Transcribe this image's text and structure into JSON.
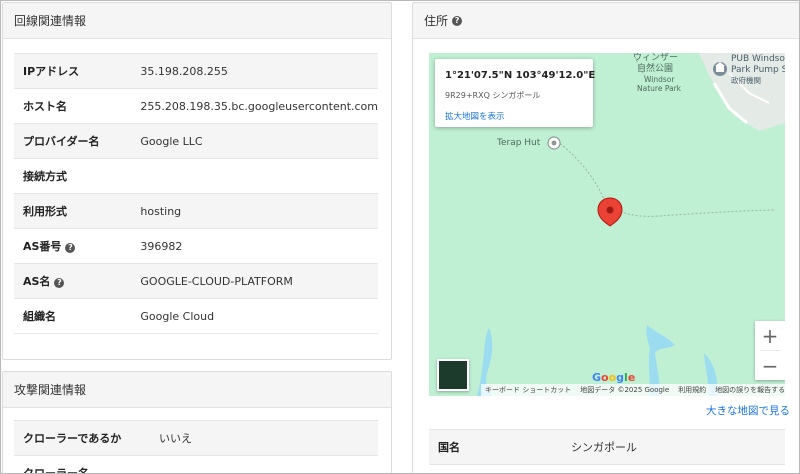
{
  "line_panel": {
    "title": "回線関連情報",
    "rows": [
      {
        "key": "IPアドレス",
        "value": "35.198.208.255",
        "help": false
      },
      {
        "key": "ホスト名",
        "value": "255.208.198.35.bc.googleusercontent.com",
        "help": false
      },
      {
        "key": "プロバイダー名",
        "value": "Google LLC",
        "help": false
      },
      {
        "key": "接続方式",
        "value": "",
        "help": false
      },
      {
        "key": "利用形式",
        "value": "hosting",
        "help": false
      },
      {
        "key": "AS番号",
        "value": "396982",
        "help": true
      },
      {
        "key": "AS名",
        "value": "GOOGLE-CLOUD-PLATFORM",
        "help": true
      },
      {
        "key": "組織名",
        "value": "Google Cloud",
        "help": false
      }
    ]
  },
  "attack_panel": {
    "title": "攻撃関連情報",
    "rows": [
      {
        "key": "クローラーであるか",
        "value": "いいえ"
      },
      {
        "key": "クローラー名",
        "value": ""
      }
    ]
  },
  "address_panel": {
    "title": "住所",
    "map": {
      "infocard": {
        "coordinates": "1°21'07.5\"N 103°49'12.0\"E",
        "plus_code": "9R29+RXQ シンガポール",
        "enlarge_link": "拡大地図を表示"
      },
      "labels": {
        "terap_hut": "Terap Hut",
        "windsor_jp1": "ウィンザー",
        "windsor_jp2": "自然公園",
        "windsor_en1": "Windsor",
        "windsor_en2": "Nature Park",
        "pub_line1": "PUB Windsor",
        "pub_line2": "Park Pump Sta",
        "pub_line3": "政府機関"
      },
      "zoom_in": "+",
      "zoom_out": "−",
      "logo": "Google",
      "attribution": [
        "キーボード ショートカット",
        "地図データ ©2025 Google",
        "利用規約",
        "地図の誤りを報告する"
      ],
      "colors": {
        "land": "#bff0d3",
        "water": "#9cdcf1",
        "pin": "#ea4335"
      }
    },
    "bigmap_link": "大きな地図で見る",
    "rows": [
      {
        "key": "国名",
        "value": "シンガポール"
      }
    ]
  }
}
